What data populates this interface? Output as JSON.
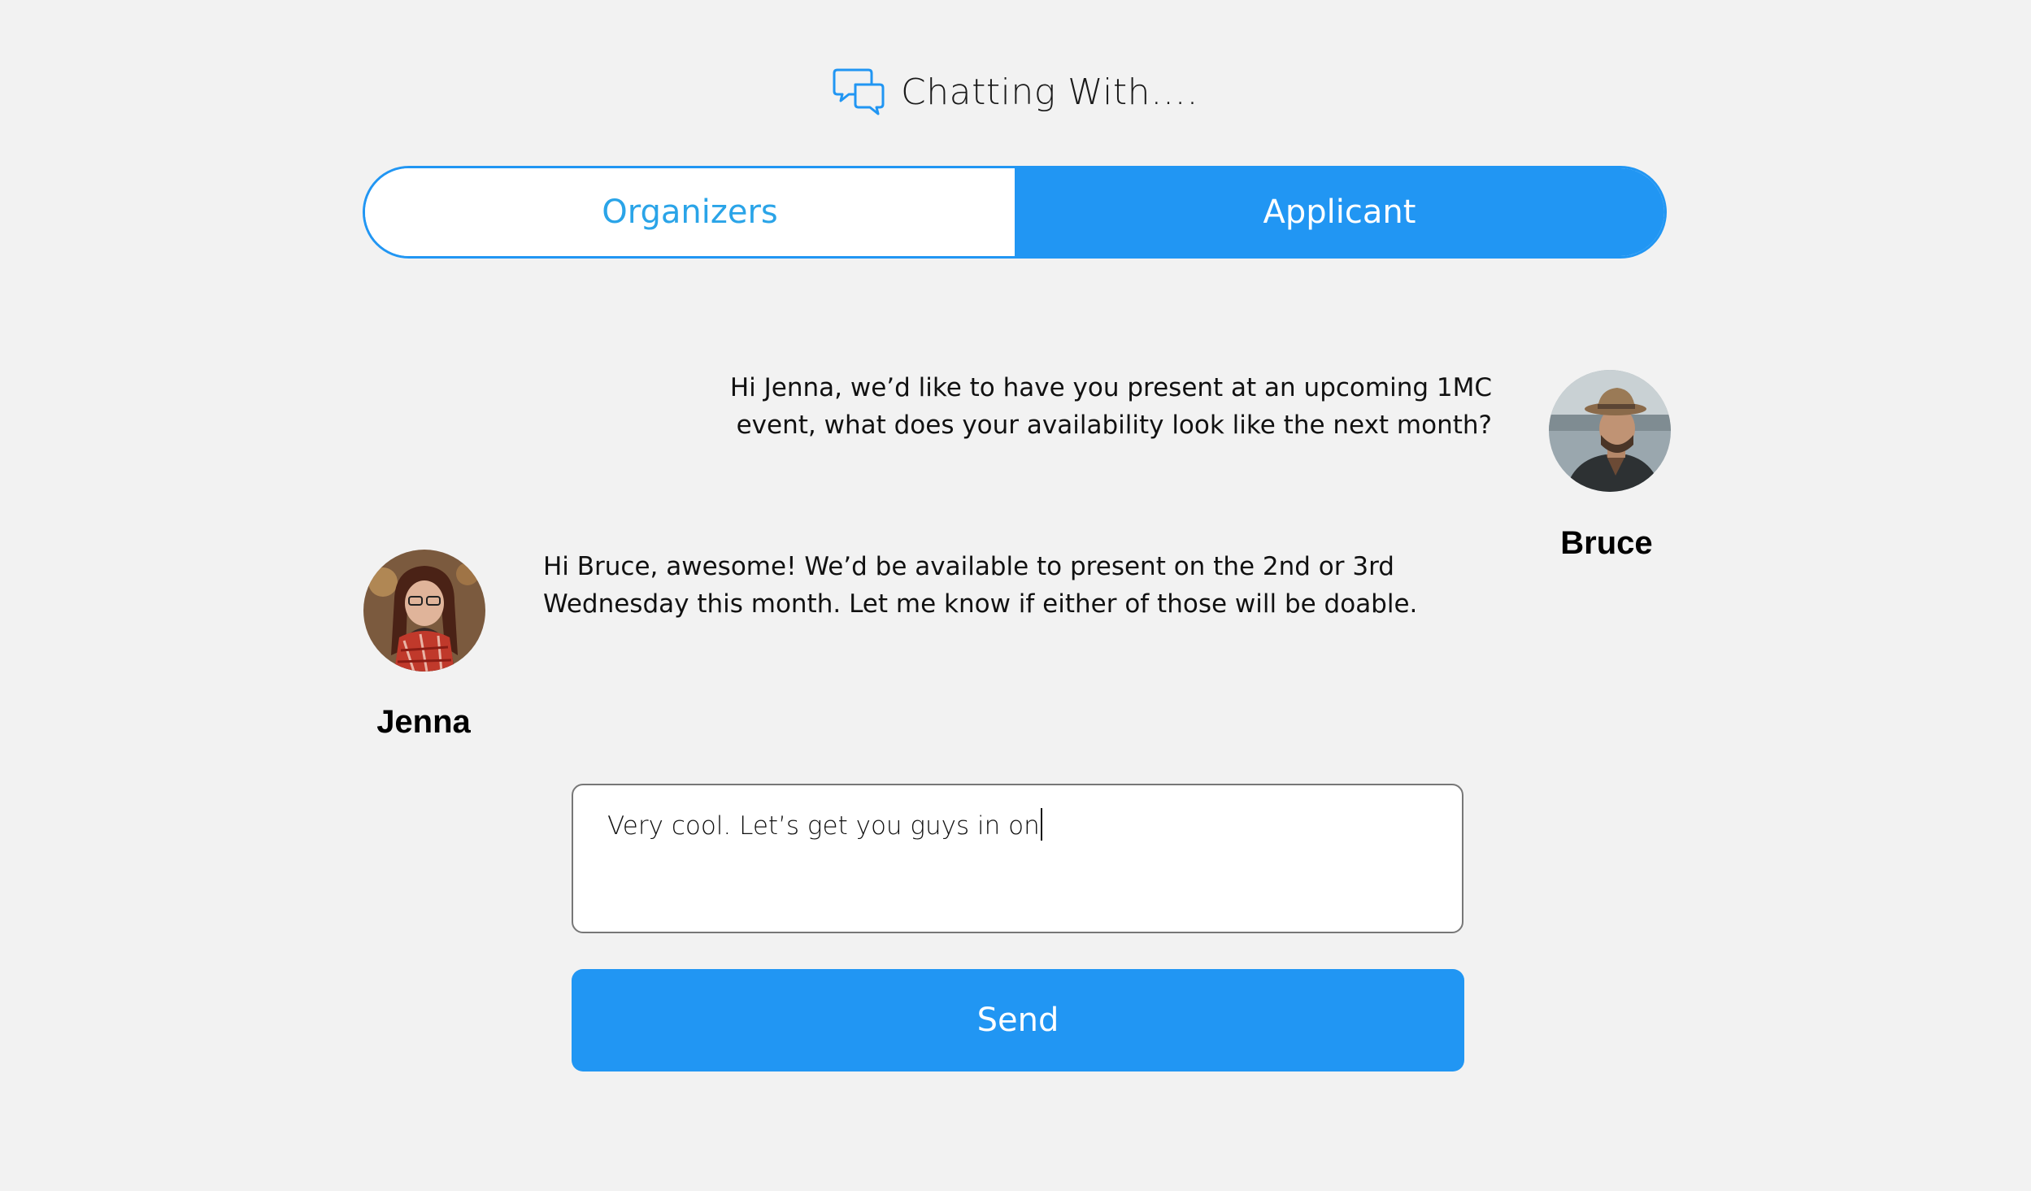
{
  "header": {
    "icon": "chat-bubbles-icon",
    "title": "Chatting With…."
  },
  "tabs": [
    {
      "label": "Organizers",
      "active": false
    },
    {
      "label": "Applicant",
      "active": true
    }
  ],
  "messages": [
    {
      "sender": "Bruce",
      "side": "right",
      "text": "Hi Jenna, we’d like to have you present at an upcoming 1MC event, what does your availability look like the next month?"
    },
    {
      "sender": "Jenna",
      "side": "left",
      "text": "Hi Bruce, awesome! We’d be available to present on the 2nd or 3rd Wednesday this month. Let me know if either of those will be doable."
    }
  ],
  "composer": {
    "value": "Very cool. Let’s get you guys in on"
  },
  "send_button": {
    "label": "Send"
  },
  "colors": {
    "accent": "#2196f3",
    "background": "#f2f2f2"
  }
}
